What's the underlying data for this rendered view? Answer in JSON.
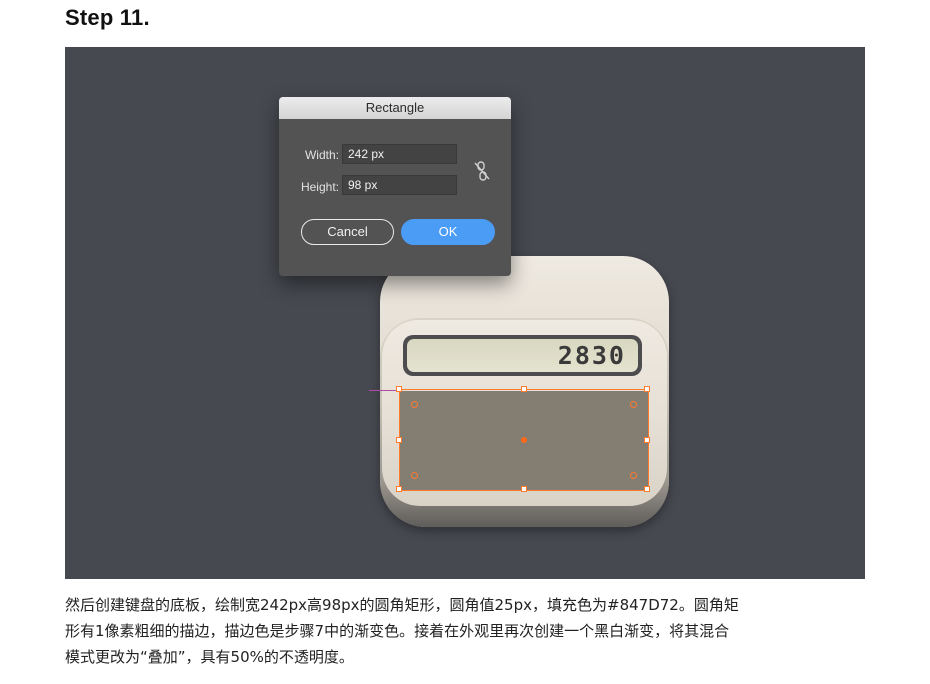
{
  "heading": "Step 11.",
  "dialog": {
    "title": "Rectangle",
    "width_label": "Width:",
    "width_value": "242 px",
    "height_label": "Height:",
    "height_value": "98 px",
    "link_icon": "unlink-icon",
    "cancel_label": "Cancel",
    "ok_label": "OK"
  },
  "calculator": {
    "display_value": "2830",
    "key_base_fill": "#847D72"
  },
  "selection": {
    "stroke_color": "#ff7a2b"
  },
  "description": {
    "line1": "然后创建键盘的底板，绘制宽242px高98px的圆角矩形，圆角值25px，填充色为#847D72。圆角矩",
    "line2": "形有1像素粗细的描边，描边色是步骤7中的渐变色。接着在外观里再次创建一个黑白渐变，将其混合",
    "line3": "模式更改为“叠加”，具有50%的不透明度。"
  }
}
